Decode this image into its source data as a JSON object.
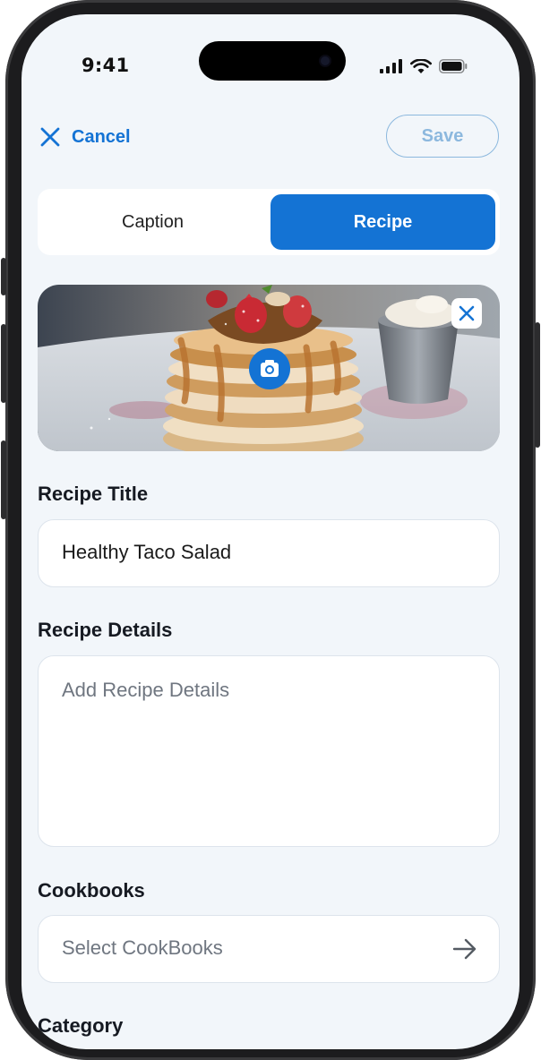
{
  "status_bar": {
    "time": "9:41",
    "icons": [
      "signal-icon",
      "wifi-icon",
      "battery-icon"
    ]
  },
  "header": {
    "cancel_label": "Cancel",
    "save_label": "Save",
    "cancel_icon": "close-icon"
  },
  "tabs": [
    {
      "label": "Caption",
      "selected": false
    },
    {
      "label": "Recipe",
      "selected": true
    }
  ],
  "photo": {
    "description_icon": "camera-icon",
    "remove_icon": "close-icon"
  },
  "form": {
    "title_label": "Recipe Title",
    "title_value": "Healthy Taco Salad",
    "details_label": "Recipe Details",
    "details_placeholder": "Add Recipe Details",
    "cookbooks_label": "Cookbooks",
    "cookbooks_placeholder": "Select CookBooks",
    "category_label": "Category"
  },
  "colors": {
    "accent": "#1473d4",
    "background": "#f2f6fa",
    "save_disabled": "#8cb8de",
    "placeholder": "#6f7680"
  }
}
